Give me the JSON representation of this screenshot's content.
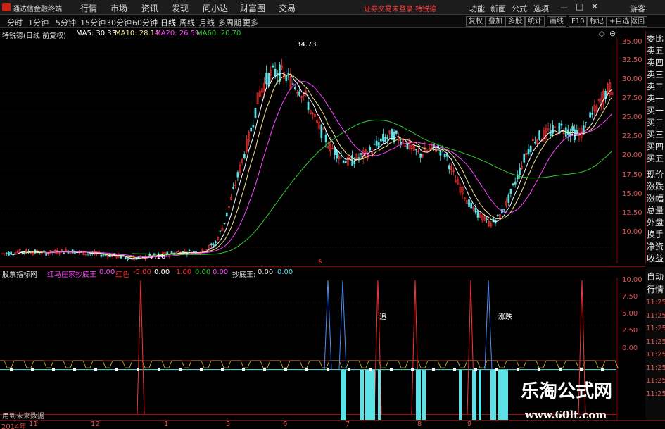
{
  "app": {
    "title": "通达信金融终端"
  },
  "menu": [
    "行情",
    "市场",
    "资讯",
    "发现",
    "问小达",
    "财富圈",
    "交易"
  ],
  "notice": "证券交易未登录 特锐德",
  "right_menu": [
    "功能",
    "新面",
    "公式",
    "选项",
    "游客"
  ],
  "periods": [
    "分时",
    "1分钟",
    "5分钟",
    "15分钟",
    "30分钟",
    "60分钟",
    "日线",
    "周线",
    "月线",
    "多周期",
    "更多"
  ],
  "active_period": "日线",
  "tools": [
    "复权",
    "叠加",
    "多股",
    "统计",
    "画线",
    "F10",
    "标记",
    "+自选",
    "返回"
  ],
  "stock_label": "特锐德(日线 前复权)",
  "ma": [
    {
      "label": "MA5: 30.33",
      "color": "#ffffff"
    },
    {
      "label": "MA10: 28.14",
      "color": "#f0e68c"
    },
    {
      "label": "MA20: 26.59",
      "color": "#ff44ff"
    },
    {
      "label": "MA60: 20.70",
      "color": "#33cc33"
    }
  ],
  "price_ticks": [
    "35.00",
    "32.50",
    "30.00",
    "27.50",
    "25.00",
    "22.50",
    "20.00",
    "17.50",
    "15.00",
    "12.50",
    "10.00"
  ],
  "high_label": "34.73",
  "low_label": "7.16",
  "right_panel": [
    "委比",
    "卖五",
    "卖四",
    "卖三",
    "卖二",
    "卖一",
    "买一",
    "买二",
    "买三",
    "买四",
    "买五",
    "现价",
    "涨跌",
    "涨幅",
    "总量",
    "外盘",
    "换手",
    "净资",
    "收益"
  ],
  "indicator_line": {
    "name": "股票指标网",
    "formula": "红马庄家抄底王",
    "v1": "0.00",
    "v2_label": "红色",
    "v2": "-5.00",
    "v3": "0.00",
    "v4": "1.00",
    "v5": "0.00",
    "v6": "0.00",
    "v7_label": "抄底王:",
    "v7": "0.00",
    "v8": "0.00"
  },
  "indicator_ticks": [
    "10.00",
    "7.50",
    "5.00",
    "2.50",
    "0.00"
  ],
  "right_panel_2": [
    "自动",
    "行情"
  ],
  "time_labels": [
    "11:25",
    "11:25",
    "11:25",
    "11:25",
    "11:25",
    "11:25",
    "11:25",
    "11:25"
  ],
  "status_text": "用到未来数据",
  "date_labels": [
    "2014年",
    "11",
    "12",
    "1",
    "5",
    "6",
    "7",
    "8",
    "9"
  ],
  "marker_texts": [
    "追",
    "涨跌"
  ],
  "watermark": {
    "line1": "乐淘公式网",
    "line2": "www.60lt.com"
  },
  "chart_data": {
    "type": "candlestick",
    "ylim": [
      8.5,
      36.5
    ],
    "ma_labels": [
      "MA5",
      "MA10",
      "MA20",
      "MA60"
    ],
    "price_profile": [
      [
        0,
        9.2
      ],
      [
        10,
        9.5
      ],
      [
        20,
        9.3
      ],
      [
        30,
        9.6
      ],
      [
        40,
        9.2
      ],
      [
        50,
        9.0
      ],
      [
        60,
        8.6
      ],
      [
        70,
        9.0
      ],
      [
        80,
        9.4
      ],
      [
        90,
        9.5
      ],
      [
        96,
        10.5
      ],
      [
        100,
        13
      ],
      [
        104,
        17
      ],
      [
        108,
        21
      ],
      [
        112,
        25
      ],
      [
        116,
        30
      ],
      [
        120,
        32
      ],
      [
        124,
        32.8
      ],
      [
        128,
        32
      ],
      [
        132,
        31
      ],
      [
        136,
        30
      ],
      [
        140,
        27
      ],
      [
        144,
        25
      ],
      [
        148,
        23
      ],
      [
        152,
        22
      ],
      [
        156,
        21
      ],
      [
        160,
        21.5
      ],
      [
        164,
        22
      ],
      [
        168,
        23
      ],
      [
        172,
        24
      ],
      [
        176,
        24.5
      ],
      [
        180,
        24
      ],
      [
        184,
        23
      ],
      [
        188,
        22
      ],
      [
        192,
        22.5
      ],
      [
        196,
        23
      ],
      [
        200,
        22
      ],
      [
        204,
        19
      ],
      [
        208,
        17
      ],
      [
        212,
        15
      ],
      [
        216,
        14
      ],
      [
        220,
        13
      ],
      [
        224,
        14
      ],
      [
        228,
        16
      ],
      [
        232,
        19
      ],
      [
        236,
        22
      ],
      [
        240,
        24
      ],
      [
        244,
        24.5
      ],
      [
        248,
        25
      ],
      [
        252,
        25.5
      ],
      [
        256,
        25
      ],
      [
        260,
        24.5
      ],
      [
        264,
        26
      ],
      [
        268,
        28
      ],
      [
        272,
        30
      ],
      [
        276,
        31
      ]
    ]
  },
  "colors": {
    "up": "#ff3333",
    "down": "#00ffff",
    "grid": "#8b0000",
    "cyan": "#5ce1e6"
  }
}
